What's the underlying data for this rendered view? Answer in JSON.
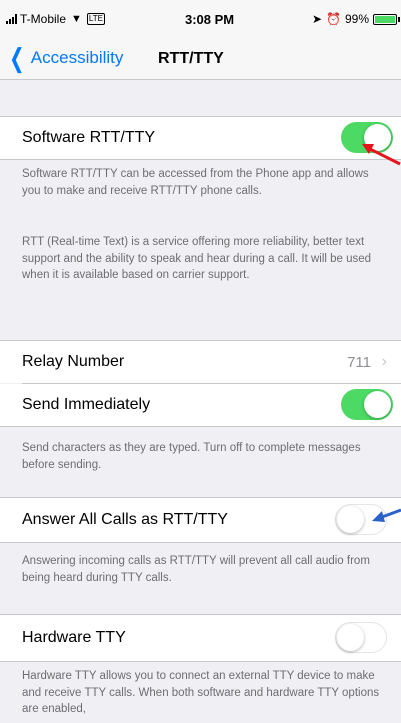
{
  "status_bar": {
    "carrier": "T-Mobile",
    "network": "LTE",
    "time": "3:08 PM",
    "battery": "99%"
  },
  "navbar": {
    "back_label": "Accessibility",
    "title": "RTT/TTY"
  },
  "rows": {
    "software_rtt": {
      "label": "Software RTT/TTY",
      "toggle_on": true
    },
    "relay_number": {
      "label": "Relay Number",
      "value": "711"
    },
    "send_immediately": {
      "label": "Send Immediately",
      "toggle_on": true
    },
    "answer_all": {
      "label": "Answer All Calls as RTT/TTY",
      "toggle_on": false
    },
    "hardware_tty": {
      "label": "Hardware TTY",
      "toggle_on": false
    }
  },
  "footers": {
    "software_1": "Software RTT/TTY can be accessed from the Phone app and allows you to make and receive RTT/TTY phone calls.",
    "software_2": "RTT (Real-time Text) is a service offering more reliability, better text support and the ability to speak and hear during a call. It will be used when it is available based on carrier support.",
    "send_immediately": "Send characters as they are typed. Turn off to complete messages before sending.",
    "answer_all": "Answering incoming calls as RTT/TTY will prevent all call audio from being heard during TTY calls.",
    "hardware": "Hardware TTY allows you to connect an external TTY device to make and receive TTY calls. When both software and hardware TTY options are enabled,"
  },
  "colors": {
    "accent": "#007aff",
    "toggle_on": "#4cd964",
    "annotation_red": "#e8141a",
    "annotation_blue": "#2a62c9"
  }
}
